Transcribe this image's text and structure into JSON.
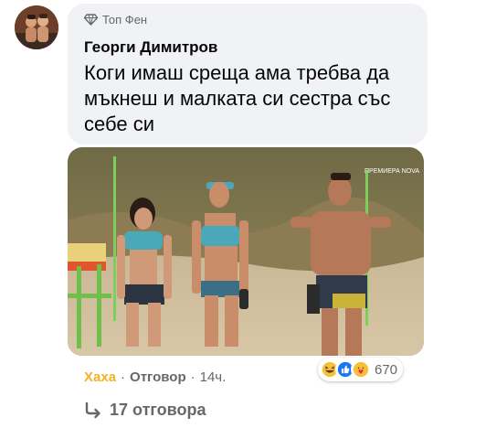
{
  "comment": {
    "badge": "Топ Фен",
    "author": "Георги Димитров",
    "text": "Коги имаш среща ама требва да мъкнеш и малката си сестра със себе си"
  },
  "photo": {
    "watermark": "ПРЕМИЕРА NOVA"
  },
  "actions": {
    "reaction_label": "Хаха",
    "reply_label": "Отговор",
    "separator": "·",
    "timestamp": "14ч."
  },
  "reactions": {
    "icons": [
      "haha-icon",
      "like-icon",
      "care-icon"
    ],
    "count": "670"
  },
  "replies": {
    "label": "17 отговора"
  },
  "colors": {
    "bubble": "#f0f2f5",
    "haha": "#f7b125",
    "secondary_text": "#65676b"
  }
}
